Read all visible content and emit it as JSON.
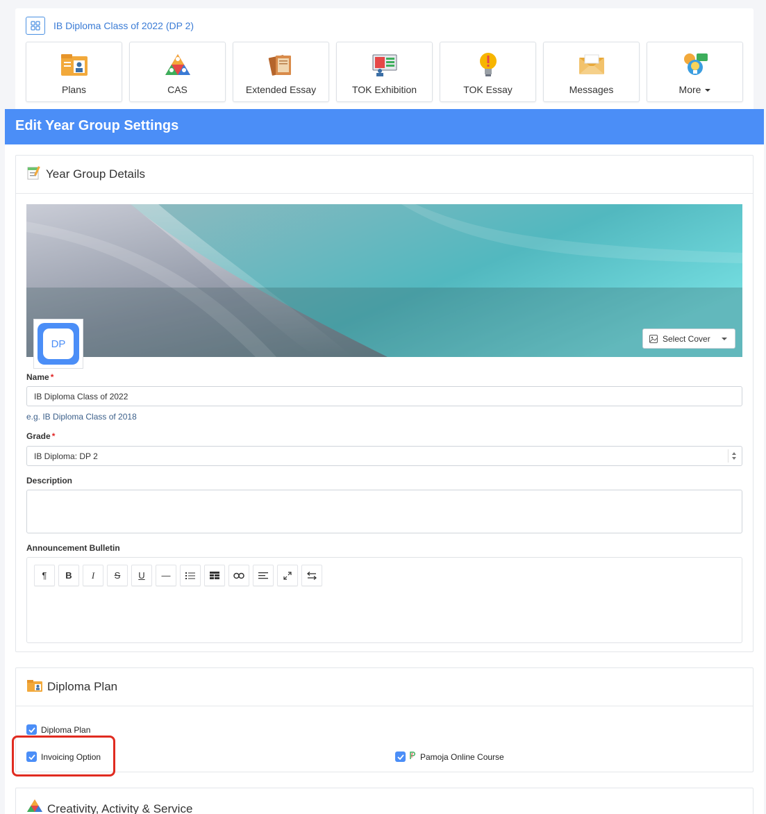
{
  "breadcrumb": {
    "title": "IB Diploma Class of 2022 (DP 2)",
    "icon": "grid-icon"
  },
  "tiles": [
    {
      "label": "Plans",
      "icon": "plans-icon"
    },
    {
      "label": "CAS",
      "icon": "cas-triangle-icon"
    },
    {
      "label": "Extended Essay",
      "icon": "books-icon"
    },
    {
      "label": "TOK Exhibition",
      "icon": "exhibition-icon"
    },
    {
      "label": "TOK Essay",
      "icon": "lightbulb-icon"
    },
    {
      "label": "Messages",
      "icon": "envelope-icon"
    },
    {
      "label": "More",
      "icon": "more-icon"
    }
  ],
  "page_title": "Edit Year Group Settings",
  "details": {
    "title": "Year Group Details",
    "select_cover": "Select Cover",
    "avatar_text": "DP",
    "name_label": "Name",
    "name_value": "IB Diploma Class of 2022",
    "name_hint": "e.g. IB Diploma Class of 2018",
    "grade_label": "Grade",
    "grade_value": "IB Diploma: DP 2",
    "description_label": "Description",
    "description_value": "",
    "bulletin_label": "Announcement Bulletin",
    "toolbar": [
      "¶",
      "B",
      "I",
      "S",
      "U",
      "—",
      "list",
      "table",
      "link",
      "align",
      "expand",
      "swap"
    ]
  },
  "diploma_plan": {
    "title": "Diploma Plan",
    "options": [
      {
        "label": "Diploma Plan",
        "checked": true
      },
      {
        "label": "Invoicing Option",
        "checked": true
      },
      {
        "label": "Pamoja Online Course",
        "checked": true
      }
    ]
  },
  "cas": {
    "title": "Creativity, Activity & Service"
  },
  "colors": {
    "accent": "#4b8ef7",
    "highlight": "#e02b20"
  }
}
